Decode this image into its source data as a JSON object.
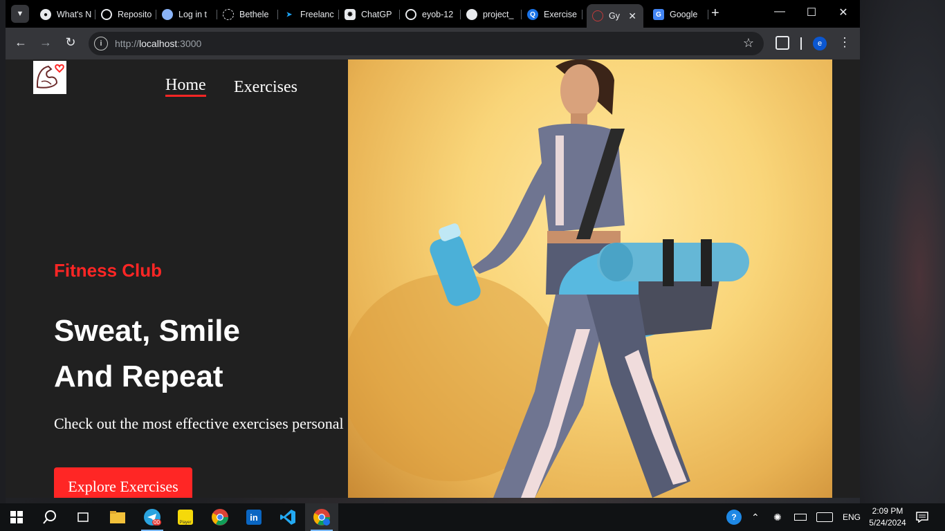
{
  "browser": {
    "tabs": [
      {
        "title": "What's N",
        "icon": "whatsapp-icon"
      },
      {
        "title": "Reposito",
        "icon": "github-icon"
      },
      {
        "title": "Log in t",
        "icon": "login-icon"
      },
      {
        "title": "Bethele",
        "icon": "loading-icon"
      },
      {
        "title": "Freelanc",
        "icon": "freelance-icon"
      },
      {
        "title": "ChatGP",
        "icon": "chatgpt-icon"
      },
      {
        "title": "eyob-12",
        "icon": "github-icon"
      },
      {
        "title": "project_",
        "icon": "github-icon"
      },
      {
        "title": "Exercise",
        "icon": "exercise-icon"
      },
      {
        "title": "Gy",
        "icon": "gym-icon",
        "active": true
      },
      {
        "title": "Google",
        "icon": "google-translate-icon"
      }
    ],
    "url_prefix": "http://",
    "url_host": "localhost",
    "url_port": ":3000",
    "profile_initial": "e"
  },
  "page": {
    "nav": {
      "home": "Home",
      "exercises": "Exercises"
    },
    "hero": {
      "tag": "Fitness Club",
      "title_line1": "Sweat, Smile",
      "title_line2": "And Repeat",
      "description": "Check out the most effective exercises personal",
      "button": "Explore Exercises"
    },
    "colors": {
      "accent": "#ff2625",
      "background": "#202020",
      "text": "#ffffff"
    }
  },
  "taskbar": {
    "apps": [
      "start-icon",
      "search-icon",
      "task-view-icon",
      "file-explorer-icon",
      "telegram-icon",
      "player-icon",
      "chrome-icon",
      "linkedin-icon",
      "vscode-icon",
      "chrome-dev-icon"
    ],
    "telegram_badge": "00",
    "player_label": "Player",
    "language": "ENG",
    "time": "2:09 PM",
    "date": "5/24/2024"
  }
}
